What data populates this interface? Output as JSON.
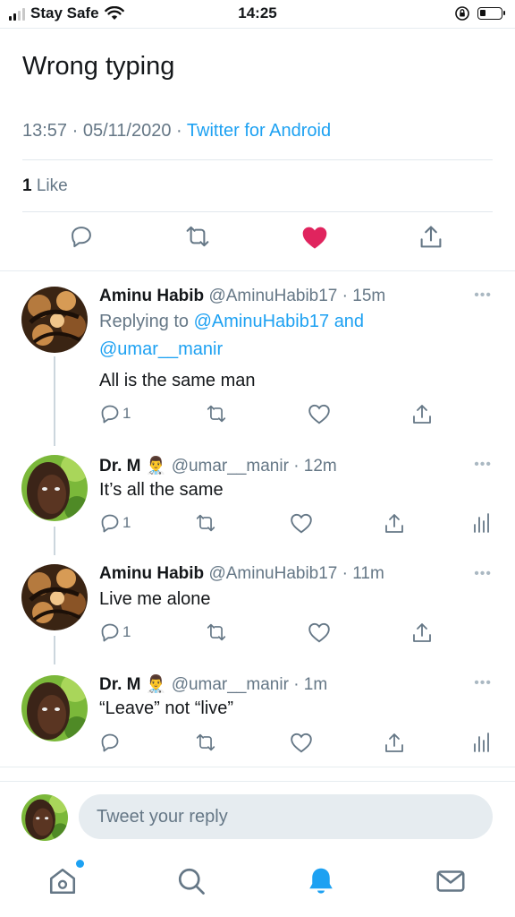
{
  "status_bar": {
    "carrier": "Stay Safe",
    "time": "14:25",
    "battery_level": 0.3
  },
  "tweet": {
    "text": "Wrong typing",
    "time": "13:57",
    "date": "05/11/2020",
    "source": "Twitter for Android",
    "likes_count": "1",
    "likes_label": "Like",
    "liked": true,
    "icons": [
      "reply-icon",
      "retweet-icon",
      "like-icon",
      "share-icon"
    ],
    "like_color": "#e0245e"
  },
  "replies": [
    {
      "name": "Aminu Habib",
      "handle": "@AminuHabib17",
      "age": "· 15m",
      "replying_prefix": "Replying to",
      "replying_to_1": "@AminuHabib17",
      "replying_and": "and",
      "replying_to_2": "@umar__manir",
      "text": "All is the same man",
      "reply_count": "1"
    },
    {
      "name": "Dr. M",
      "badge": "👨‍⚕️",
      "handle": "@umar__manir",
      "age": "· 12m",
      "text": "It’s all the same",
      "reply_count": "1"
    },
    {
      "name": "Aminu Habib",
      "handle": "@AminuHabib17",
      "age": "· 11m",
      "text": "Live me alone",
      "reply_count": "1"
    },
    {
      "name": "Dr. M",
      "badge": "👨‍⚕️",
      "handle": "@umar__manir",
      "age": "· 1m",
      "text": "“Leave” not “live”",
      "reply_count": ""
    }
  ],
  "more_label": "•••",
  "reply_bar": {
    "placeholder": "Tweet your reply"
  },
  "bottom_nav": {
    "items": [
      "home-icon",
      "search-icon",
      "notifications-icon",
      "messages-icon"
    ],
    "active": "notifications-icon"
  },
  "colors": {
    "accent": "#1da1f2",
    "muted": "#657786",
    "divider": "#e6ecf0"
  }
}
